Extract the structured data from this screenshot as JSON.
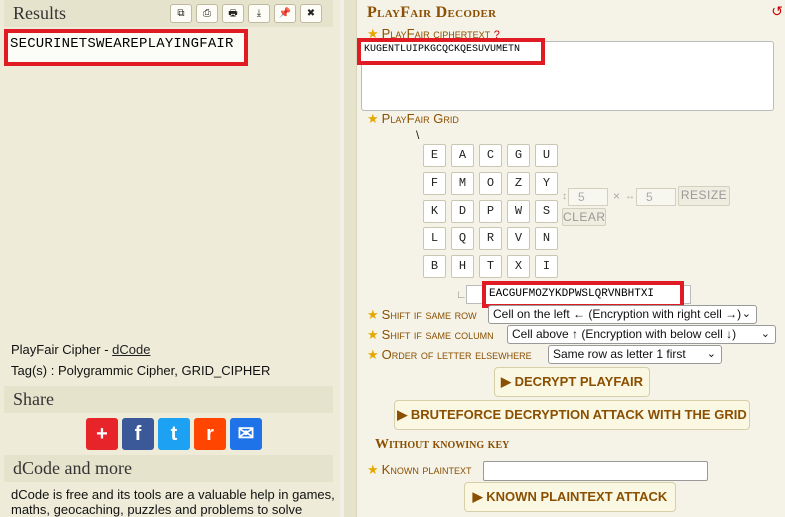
{
  "left": {
    "results_title": "Results",
    "result_text": "SECURINETSWEAREPLAYINGFAIR",
    "toolbar": [
      {
        "name": "copy-icon",
        "glyph": "⧉"
      },
      {
        "name": "print-icon",
        "glyph": "⎙"
      },
      {
        "name": "printer-icon",
        "glyph": "🖶"
      },
      {
        "name": "download-icon",
        "glyph": "⤓"
      },
      {
        "name": "pin-icon",
        "glyph": "📌"
      },
      {
        "name": "close-icon",
        "glyph": "✖"
      }
    ],
    "tool_name": "PlayFair Cipher - ",
    "tool_link": "dCode",
    "tags": "Tag(s) : Polygrammic Cipher, GRID_CIPHER",
    "share_title": "Share",
    "share_buttons": [
      {
        "name": "addthis-icon",
        "glyph": "+",
        "color": "#e8242b"
      },
      {
        "name": "facebook-icon",
        "glyph": "f",
        "color": "#3b5998"
      },
      {
        "name": "twitter-icon",
        "glyph": "t",
        "color": "#1da1f2"
      },
      {
        "name": "reddit-icon",
        "glyph": "r",
        "color": "#ff4500"
      },
      {
        "name": "email-icon",
        "glyph": "✉",
        "color": "#1e73e8"
      }
    ],
    "more_title": "dCode and more",
    "more_text_1": "dCode is free and its tools are a valuable help in games,",
    "more_text_2": "maths, geocaching, puzzles and problems to solve"
  },
  "right": {
    "title": "PlayFair Decoder",
    "ciphertext_label": "PlayFair ciphertext",
    "help_icon": "?",
    "ciphertext_value": "KUGENTLUIPKGCQCKQESUVUMETN",
    "grid_label": "PlayFair Grid",
    "grid_corner": "\\",
    "grid": [
      [
        "E",
        "A",
        "C",
        "G",
        "U"
      ],
      [
        "F",
        "M",
        "O",
        "Z",
        "Y"
      ],
      [
        "K",
        "D",
        "P",
        "W",
        "S"
      ],
      [
        "L",
        "Q",
        "R",
        "V",
        "N"
      ],
      [
        "B",
        "H",
        "T",
        "X",
        "I"
      ]
    ],
    "rows_value": "5",
    "cols_value": "5",
    "times": "×",
    "resize_label": "RESIZE",
    "clear_label": "CLEAR",
    "key_corner": "∟",
    "grid_key": "EACGUFMOZYKDPWSLQRVNBHTXI",
    "shift_row_label": "Shift if same row",
    "shift_row_value": "Cell on the left ← (Encryption with right cell →)",
    "shift_col_label": "Shift if same column",
    "shift_col_value": "Cell above ↑ (Encryption with below cell ↓)",
    "order_label": "Order of letter elsewhere",
    "order_value": "Same row as letter 1 first",
    "decrypt_button": "▶ DECRYPT PLAYFAIR",
    "bruteforce_button": "▶ BRUTEFORCE DECRYPTION ATTACK WITH THE GRID",
    "without_key_title": "Without knowing key",
    "known_plaintext_label": "Known plaintext",
    "known_plaintext_value": "",
    "known_plaintext_button": "▶ KNOWN PLAINTEXT ATTACK"
  }
}
